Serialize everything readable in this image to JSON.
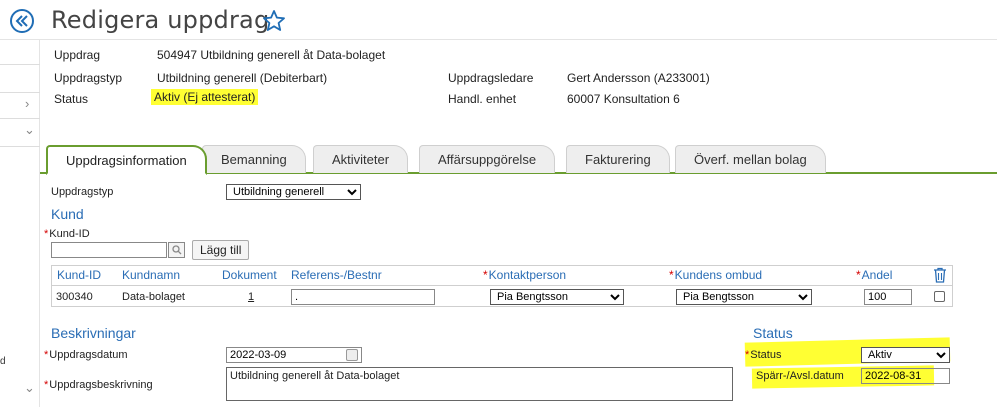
{
  "header": {
    "title": "Redigera uppdrag"
  },
  "info": {
    "uppdrag_label": "Uppdrag",
    "uppdrag_value": "504947 Utbildning generell åt Data-bolaget",
    "uppdragstyp_label": "Uppdragstyp",
    "uppdragstyp_value": "Utbildning generell (Debiterbart)",
    "status_label": "Status",
    "status_value": "Aktiv (Ej attesterat)",
    "uppdragsledare_label": "Uppdragsledare",
    "uppdragsledare_value": "Gert Andersson (A233001)",
    "handl_enhet_label": "Handl. enhet",
    "handl_enhet_value": "60007 Konsultation 6"
  },
  "tabs": [
    {
      "label": "Uppdragsinformation"
    },
    {
      "label": "Bemanning"
    },
    {
      "label": "Aktiviteter"
    },
    {
      "label": "Affärsuppgörelse"
    },
    {
      "label": "Fakturering"
    },
    {
      "label": "Överf. mellan bolag"
    }
  ],
  "form": {
    "uppdragstyp_label": "Uppdragstyp",
    "uppdragstyp_selected": "Utbildning generell",
    "kund_title": "Kund",
    "kund_id_label": "Kund-ID",
    "kund_id_value": "",
    "add_button": "Lägg till",
    "table": {
      "headers": {
        "kund_id": "Kund-ID",
        "kundnamn": "Kundnamn",
        "dokument": "Dokument",
        "referens": "Referens-/Bestnr",
        "kontaktperson": "Kontaktperson",
        "kundens_ombud": "Kundens ombud",
        "andel": "Andel"
      },
      "row": {
        "kund_id": "300340",
        "kundnamn": "Data-bolaget",
        "dokument": "1",
        "referens": ".",
        "kontaktperson": "Pia Bengtsson",
        "kundens_ombud": "Pia Bengtsson",
        "andel": "100"
      }
    },
    "beskrivningar_title": "Beskrivningar",
    "uppdragsdatum_label": "Uppdragsdatum",
    "uppdragsdatum_value": "2022-03-09",
    "uppdragsbeskrivning_label": "Uppdragsbeskrivning",
    "uppdragsbeskrivning_value": "Utbildning generell åt Data-bolaget",
    "status_title": "Status",
    "status_label": "Status",
    "status_selected": "Aktiv",
    "sparr_label": "Spärr-/Avsl.datum",
    "sparr_value": "2022-08-31"
  },
  "sidebar": {
    "fragment_text": "d"
  },
  "colors": {
    "accent_blue": "#2a6db5",
    "tab_green": "#6a9d2f",
    "highlight_yellow": "#ffff33",
    "required_red": "#d40000"
  }
}
